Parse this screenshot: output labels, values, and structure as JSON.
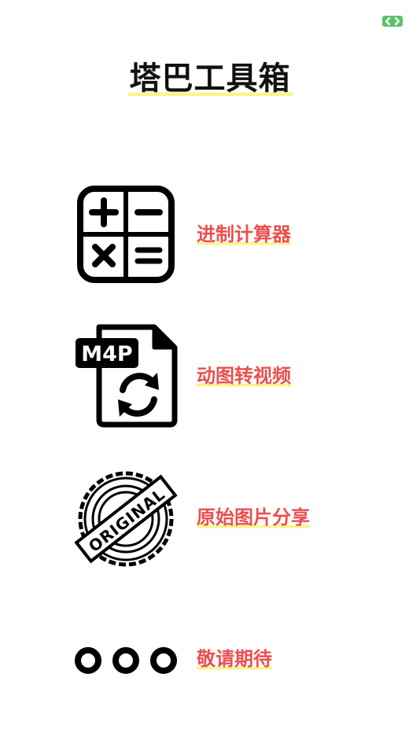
{
  "app": {
    "title": "塔巴工具箱"
  },
  "tools": [
    {
      "label": "进制计算器",
      "icon": "calculator-icon"
    },
    {
      "label": "动图转视频",
      "icon": "m4p-convert-icon"
    },
    {
      "label": "原始图片分享",
      "icon": "original-stamp-icon"
    },
    {
      "label": "敬请期待",
      "icon": "more-dots-icon"
    }
  ],
  "m4p_icon_text": "M4P",
  "original_stamp_text": "ORIGINAL",
  "colors": {
    "accent_text": "#ea4f4f",
    "underline_highlight": "#fbf58a",
    "badge_green": "#5cc26a",
    "title_text": "#111111"
  }
}
